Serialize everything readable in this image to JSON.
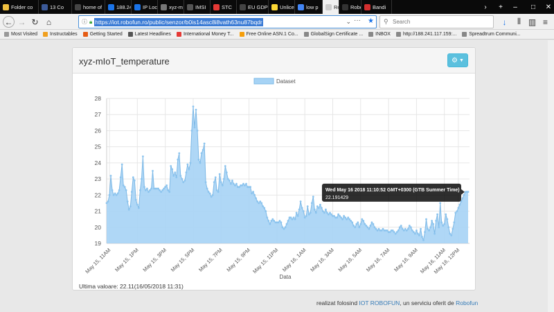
{
  "browser": {
    "tabs": [
      {
        "label": "Folder co",
        "color": "#f0c040"
      },
      {
        "label": "13 Co",
        "color": "#3b5998"
      },
      {
        "label": "home of",
        "color": "#444"
      },
      {
        "label": "188.24",
        "color": "#1a73e8"
      },
      {
        "label": "IP Loc",
        "color": "#1a73e8"
      },
      {
        "label": "xyz-m",
        "color": "#777"
      },
      {
        "label": "IMSI",
        "color": "#555"
      },
      {
        "label": "STC",
        "color": "#e53935"
      },
      {
        "label": "EU GDPR",
        "color": "#444"
      },
      {
        "label": "Unlice",
        "color": "#fdd835"
      },
      {
        "label": "low p",
        "color": "#4285f4"
      },
      {
        "label": "Re",
        "color": "#ccc",
        "active": true
      },
      {
        "label": "Robo",
        "color": "#333"
      },
      {
        "label": "Bandi",
        "color": "#d32f2f"
      }
    ],
    "url": "https://iot.robofun.ro/public/senzor/b0is14asc8i8vath63nu87bqdr",
    "search_placeholder": "Search",
    "bookmarks": [
      {
        "label": "Most Visited",
        "color": "#999"
      },
      {
        "label": "Instructables",
        "color": "#f0a020"
      },
      {
        "label": "Getting Started",
        "color": "#e55b13"
      },
      {
        "label": "Latest Headlines",
        "color": "#555"
      },
      {
        "label": "International Money T...",
        "color": "#e53935"
      },
      {
        "label": "Free Online ASN.1 Co...",
        "color": "#f59e0b"
      },
      {
        "label": "GlobalSign Certificate ...",
        "color": "#888"
      },
      {
        "label": "INBOX",
        "color": "#888"
      },
      {
        "label": "http://188.241.117.159:...",
        "color": "#888"
      },
      {
        "label": "Spreadtrum Communi...",
        "color": "#888"
      }
    ]
  },
  "panel": {
    "title": "xyz-mIoT_temperature",
    "last_value": "Ultima valoare: 22.11(16/05/2018 11:31)"
  },
  "tooltip": {
    "title": "Wed May 16 2018 11:10:52 GMT+0300 (GTB Summer Time)",
    "value": "22.191429"
  },
  "footer": {
    "prefix": "realizat folosind ",
    "link1": "IOT ROBOFUN",
    "middle": ", un serviciu oferit de ",
    "link2": "Robofun"
  },
  "chart_data": {
    "type": "area",
    "title": "",
    "xlabel": "Data",
    "ylabel": "",
    "legend": "Dataset",
    "legend_position": "top-center",
    "ylim": [
      19,
      28
    ],
    "yticks": [
      19,
      20,
      21,
      22,
      23,
      24,
      25,
      26,
      27,
      28
    ],
    "xticks": [
      "May 15, 11AM",
      "May 15, 1PM",
      "May 15, 3PM",
      "May 15, 5PM",
      "May 15, 7PM",
      "May 15, 9PM",
      "May 15, 11PM",
      "May 16, 1AM",
      "May 16, 3AM",
      "May 16, 5AM",
      "May 16, 7AM",
      "May 16, 9AM",
      "May 16, 11AM",
      "May 16, 12PM"
    ],
    "grid": true,
    "fill_color": "#a6d3f5",
    "line_color": "#7cb8e6",
    "series": [
      {
        "name": "Dataset",
        "points": [
          [
            10.8,
            21.5
          ],
          [
            10.9,
            21.6
          ],
          [
            11.0,
            22.0
          ],
          [
            11.1,
            23.2
          ],
          [
            11.2,
            22.3
          ],
          [
            11.3,
            22.0
          ],
          [
            11.4,
            22.1
          ],
          [
            11.5,
            22.0
          ],
          [
            11.6,
            22.1
          ],
          [
            11.7,
            22.3
          ],
          [
            11.8,
            23.1
          ],
          [
            11.9,
            23.9
          ],
          [
            12.0,
            22.6
          ],
          [
            12.1,
            22.5
          ],
          [
            12.2,
            22.3
          ],
          [
            12.3,
            21.6
          ],
          [
            12.4,
            21.1
          ],
          [
            12.5,
            21.3
          ],
          [
            12.6,
            22.2
          ],
          [
            12.7,
            23.1
          ],
          [
            12.8,
            22.9
          ],
          [
            12.9,
            21.7
          ],
          [
            13.0,
            21.4
          ],
          [
            13.1,
            21.2
          ],
          [
            13.2,
            22.3
          ],
          [
            13.3,
            23.0
          ],
          [
            13.4,
            24.4
          ],
          [
            13.5,
            22.5
          ],
          [
            13.6,
            22.3
          ],
          [
            13.7,
            22.4
          ],
          [
            13.8,
            22.2
          ],
          [
            13.9,
            22.3
          ],
          [
            14.0,
            22.4
          ],
          [
            14.1,
            23.5
          ],
          [
            14.2,
            22.4
          ],
          [
            14.3,
            22.4
          ],
          [
            14.4,
            22.4
          ],
          [
            14.5,
            22.4
          ],
          [
            14.6,
            22.3
          ],
          [
            14.7,
            22.2
          ],
          [
            14.8,
            22.3
          ],
          [
            14.9,
            22.4
          ],
          [
            15.0,
            22.5
          ],
          [
            15.1,
            22.6
          ],
          [
            15.2,
            22.3
          ],
          [
            15.3,
            22.2
          ],
          [
            15.4,
            23.8
          ],
          [
            15.5,
            23.6
          ],
          [
            15.6,
            23.2
          ],
          [
            15.7,
            23.4
          ],
          [
            15.8,
            23.1
          ],
          [
            15.9,
            24.2
          ],
          [
            16.0,
            24.6
          ],
          [
            16.1,
            23.2
          ],
          [
            16.2,
            23.0
          ],
          [
            16.3,
            22.8
          ],
          [
            16.4,
            22.9
          ],
          [
            16.5,
            23.4
          ],
          [
            16.6,
            23.9
          ],
          [
            16.7,
            23.6
          ],
          [
            16.8,
            24.0
          ],
          [
            16.9,
            26.0
          ],
          [
            17.0,
            27.5
          ],
          [
            17.1,
            26.2
          ],
          [
            17.2,
            27.3
          ],
          [
            17.3,
            26.0
          ],
          [
            17.4,
            24.2
          ],
          [
            17.5,
            24.0
          ],
          [
            17.6,
            24.6
          ],
          [
            17.7,
            24.8
          ],
          [
            17.8,
            25.2
          ],
          [
            17.9,
            22.8
          ],
          [
            18.0,
            22.4
          ],
          [
            18.1,
            22.2
          ],
          [
            18.2,
            22.1
          ],
          [
            18.3,
            21.9
          ],
          [
            18.4,
            22.0
          ],
          [
            18.5,
            22.8
          ],
          [
            18.6,
            23.1
          ],
          [
            18.7,
            22.3
          ],
          [
            18.8,
            22.2
          ],
          [
            18.9,
            23.3
          ],
          [
            19.0,
            22.8
          ],
          [
            19.1,
            22.6
          ],
          [
            19.2,
            23.0
          ],
          [
            19.3,
            23.8
          ],
          [
            19.4,
            23.4
          ],
          [
            19.5,
            23.0
          ],
          [
            19.6,
            22.9
          ],
          [
            19.7,
            22.7
          ],
          [
            19.8,
            22.9
          ],
          [
            19.9,
            22.7
          ],
          [
            20.0,
            22.6
          ],
          [
            20.1,
            22.7
          ],
          [
            20.2,
            22.5
          ],
          [
            20.3,
            22.5
          ],
          [
            20.4,
            22.6
          ],
          [
            20.5,
            22.6
          ],
          [
            20.6,
            22.7
          ],
          [
            20.7,
            22.6
          ],
          [
            20.8,
            22.7
          ],
          [
            20.9,
            22.5
          ],
          [
            21.0,
            22.5
          ],
          [
            21.1,
            22.5
          ],
          [
            21.2,
            22.1
          ],
          [
            21.3,
            22.2
          ],
          [
            21.4,
            22.0
          ],
          [
            21.5,
            21.8
          ],
          [
            21.6,
            21.6
          ],
          [
            21.7,
            21.5
          ],
          [
            21.8,
            21.6
          ],
          [
            21.9,
            21.5
          ],
          [
            22.0,
            21.3
          ],
          [
            22.1,
            21.2
          ],
          [
            22.2,
            21.0
          ],
          [
            22.3,
            20.6
          ],
          [
            22.4,
            20.4
          ],
          [
            22.5,
            20.2
          ],
          [
            22.6,
            20.4
          ],
          [
            22.7,
            20.5
          ],
          [
            22.8,
            20.4
          ],
          [
            22.9,
            20.3
          ],
          [
            23.0,
            20.3
          ],
          [
            23.1,
            20.3
          ],
          [
            23.2,
            20.4
          ],
          [
            23.3,
            20.3
          ],
          [
            23.4,
            20.0
          ],
          [
            23.5,
            19.9
          ],
          [
            23.6,
            20.0
          ],
          [
            23.7,
            20.2
          ],
          [
            23.8,
            20.4
          ],
          [
            23.9,
            20.6
          ],
          [
            24.0,
            20.6
          ],
          [
            24.1,
            20.5
          ],
          [
            24.2,
            20.6
          ],
          [
            24.3,
            20.5
          ],
          [
            24.4,
            20.9
          ],
          [
            24.5,
            20.7
          ],
          [
            24.6,
            21.1
          ],
          [
            24.7,
            21.6
          ],
          [
            24.8,
            21.2
          ],
          [
            24.9,
            21.0
          ],
          [
            25.0,
            20.6
          ],
          [
            25.1,
            20.7
          ],
          [
            25.2,
            21.3
          ],
          [
            25.3,
            20.8
          ],
          [
            25.4,
            20.9
          ],
          [
            25.5,
            21.5
          ],
          [
            25.6,
            21.9
          ],
          [
            25.7,
            21.1
          ],
          [
            25.8,
            20.9
          ],
          [
            25.9,
            21.3
          ],
          [
            26.0,
            21.2
          ],
          [
            26.1,
            21.4
          ],
          [
            26.2,
            21.2
          ],
          [
            26.3,
            21.0
          ],
          [
            26.4,
            20.9
          ],
          [
            26.5,
            21.1
          ],
          [
            26.6,
            20.9
          ],
          [
            26.7,
            20.8
          ],
          [
            26.8,
            20.9
          ],
          [
            26.9,
            20.8
          ],
          [
            27.0,
            20.7
          ],
          [
            27.1,
            20.7
          ],
          [
            27.2,
            20.6
          ],
          [
            27.3,
            20.6
          ],
          [
            27.4,
            20.8
          ],
          [
            27.5,
            20.7
          ],
          [
            27.6,
            20.6
          ],
          [
            27.7,
            20.5
          ],
          [
            27.8,
            20.7
          ],
          [
            27.9,
            20.6
          ],
          [
            28.0,
            20.5
          ],
          [
            28.1,
            20.6
          ],
          [
            28.2,
            20.5
          ],
          [
            28.3,
            20.4
          ],
          [
            28.4,
            20.3
          ],
          [
            28.5,
            20.1
          ],
          [
            28.6,
            20.0
          ],
          [
            28.7,
            20.2
          ],
          [
            28.8,
            20.3
          ],
          [
            28.9,
            20.0
          ],
          [
            29.0,
            20.2
          ],
          [
            29.1,
            20.5
          ],
          [
            29.2,
            20.4
          ],
          [
            29.3,
            20.2
          ],
          [
            29.4,
            20.1
          ],
          [
            29.5,
            20.0
          ],
          [
            29.6,
            19.9
          ],
          [
            29.7,
            20.1
          ],
          [
            29.8,
            20.3
          ],
          [
            29.9,
            20.2
          ],
          [
            30.0,
            20.0
          ],
          [
            30.1,
            19.9
          ],
          [
            30.2,
            19.8
          ],
          [
            30.3,
            19.9
          ],
          [
            30.4,
            19.8
          ],
          [
            30.5,
            19.8
          ],
          [
            30.6,
            19.9
          ],
          [
            30.7,
            19.8
          ],
          [
            30.8,
            19.8
          ],
          [
            30.9,
            19.8
          ],
          [
            31.0,
            19.7
          ],
          [
            31.1,
            19.7
          ],
          [
            31.2,
            19.8
          ],
          [
            31.3,
            19.8
          ],
          [
            31.4,
            19.7
          ],
          [
            31.5,
            19.6
          ],
          [
            31.6,
            19.7
          ],
          [
            31.7,
            19.8
          ],
          [
            31.8,
            20.0
          ],
          [
            31.9,
            20.1
          ],
          [
            32.0,
            19.9
          ],
          [
            32.1,
            19.8
          ],
          [
            32.2,
            19.9
          ],
          [
            32.3,
            19.8
          ],
          [
            32.4,
            19.9
          ],
          [
            32.5,
            20.1
          ],
          [
            32.6,
            20.0
          ],
          [
            32.7,
            19.8
          ],
          [
            32.8,
            19.7
          ],
          [
            32.9,
            19.6
          ],
          [
            33.0,
            19.8
          ],
          [
            33.1,
            19.6
          ],
          [
            33.2,
            19.5
          ],
          [
            33.3,
            19.9
          ],
          [
            33.4,
            19.4
          ],
          [
            33.5,
            19.2
          ],
          [
            33.6,
            19.7
          ],
          [
            33.7,
            20.5
          ],
          [
            33.8,
            19.9
          ],
          [
            33.9,
            19.8
          ],
          [
            34.0,
            20.0
          ],
          [
            34.1,
            20.4
          ],
          [
            34.2,
            20.2
          ],
          [
            34.3,
            19.6
          ],
          [
            34.4,
            20.4
          ],
          [
            34.5,
            20.8
          ],
          [
            34.6,
            20.0
          ],
          [
            34.7,
            21.5
          ],
          [
            34.8,
            20.3
          ],
          [
            34.9,
            20.1
          ],
          [
            35.0,
            20.2
          ],
          [
            35.1,
            20.8
          ],
          [
            35.2,
            20.5
          ],
          [
            35.3,
            20.0
          ],
          [
            35.4,
            19.6
          ],
          [
            35.5,
            19.5
          ],
          [
            35.6,
            19.9
          ],
          [
            35.7,
            20.3
          ],
          [
            35.8,
            20.9
          ],
          [
            35.9,
            21.0
          ],
          [
            36.0,
            21.2
          ],
          [
            36.1,
            21.4
          ],
          [
            36.2,
            21.6
          ],
          [
            36.3,
            21.8
          ],
          [
            36.4,
            22.0
          ],
          [
            36.5,
            22.19
          ],
          [
            36.6,
            22.2
          ],
          [
            36.7,
            22.2
          ]
        ]
      }
    ]
  }
}
